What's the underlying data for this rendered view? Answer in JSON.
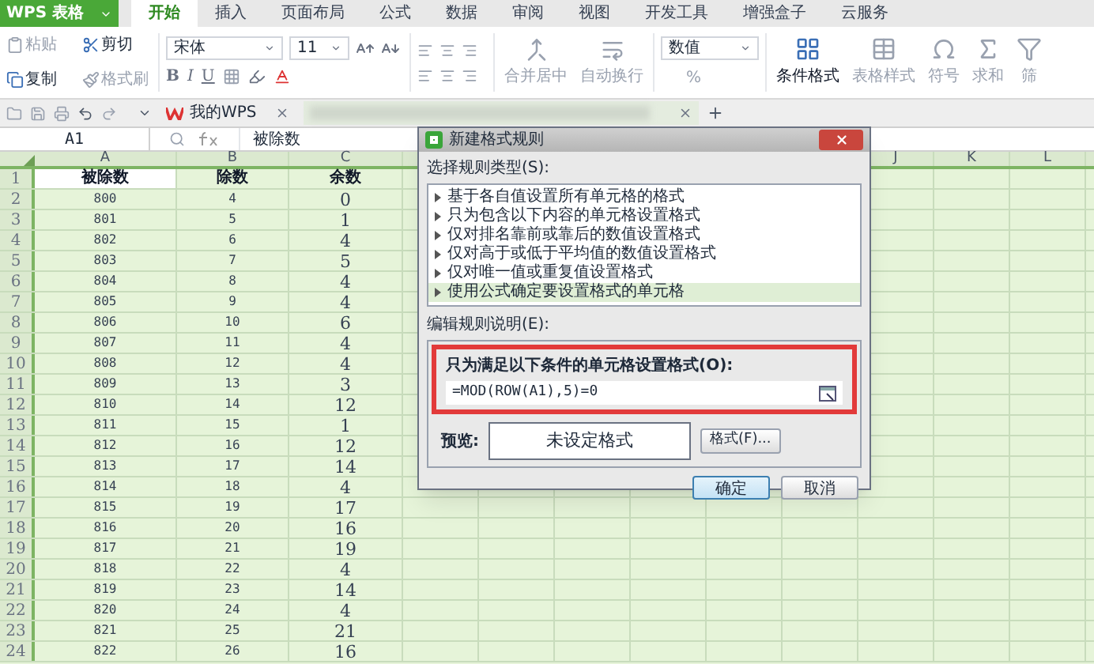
{
  "app": {
    "logo": "WPS 表格"
  },
  "menu_tabs": [
    {
      "label": "开始",
      "selected": true
    },
    {
      "label": "插入",
      "selected": false
    },
    {
      "label": "页面布局",
      "selected": false
    },
    {
      "label": "公式",
      "selected": false
    },
    {
      "label": "数据",
      "selected": false
    },
    {
      "label": "审阅",
      "selected": false
    },
    {
      "label": "视图",
      "selected": false
    },
    {
      "label": "开发工具",
      "selected": false
    },
    {
      "label": "增强盒子",
      "selected": false
    },
    {
      "label": "云服务",
      "selected": false
    }
  ],
  "ribbon": {
    "clipboard": [
      {
        "kind": "paste",
        "label": "粘贴",
        "disabled": true
      },
      {
        "kind": "cut",
        "label": "剪切",
        "disabled": false
      },
      {
        "kind": "copy",
        "label": "复制",
        "disabled": false
      },
      {
        "kind": "painter",
        "label": "格式刷",
        "disabled": true
      }
    ],
    "font": {
      "name": "宋体",
      "size": "11",
      "styles": [
        "B",
        "I",
        "U"
      ]
    },
    "wrap": [
      {
        "kind": "merge",
        "label": "合并居中",
        "disabled": true
      },
      {
        "kind": "wrap",
        "label": "自动换行",
        "disabled": true
      }
    ],
    "number": {
      "format": "数值",
      "percent": "%"
    },
    "big": [
      {
        "kind": "conditional",
        "label": "条件格式",
        "disabled": false
      },
      {
        "kind": "table",
        "label": "表格样式",
        "disabled": true
      },
      {
        "kind": "symbol",
        "label": "符号",
        "disabled": true
      },
      {
        "kind": "sum",
        "label": "求和",
        "disabled": true
      },
      {
        "kind": "filter",
        "label": "筛",
        "disabled": true
      }
    ]
  },
  "doc_tabs": [
    {
      "label": "我的WPS"
    }
  ],
  "formula_bar": {
    "cell": "A1",
    "formula": "被除数"
  },
  "sheet": {
    "columns": [
      "",
      "A",
      "B",
      "C",
      "J",
      "K",
      "L"
    ],
    "header_row": {
      "number": "1",
      "cells": [
        {
          "text": "被除数",
          "selected": true
        },
        {
          "text": "除数",
          "selected": false
        },
        {
          "text": "余数",
          "selected": false
        }
      ]
    },
    "rows": [
      [
        "2",
        "800",
        "4",
        "0"
      ],
      [
        "3",
        "801",
        "5",
        "1"
      ],
      [
        "4",
        "802",
        "6",
        "4"
      ],
      [
        "5",
        "803",
        "7",
        "5"
      ],
      [
        "6",
        "804",
        "8",
        "4"
      ],
      [
        "7",
        "805",
        "9",
        "4"
      ],
      [
        "8",
        "806",
        "10",
        "6"
      ],
      [
        "9",
        "807",
        "11",
        "4"
      ],
      [
        "10",
        "808",
        "12",
        "4"
      ],
      [
        "11",
        "809",
        "13",
        "3"
      ],
      [
        "12",
        "810",
        "14",
        "12"
      ],
      [
        "13",
        "811",
        "15",
        "1"
      ],
      [
        "14",
        "812",
        "16",
        "12"
      ],
      [
        "15",
        "813",
        "17",
        "14"
      ],
      [
        "16",
        "814",
        "18",
        "4"
      ],
      [
        "17",
        "815",
        "19",
        "17"
      ],
      [
        "18",
        "816",
        "20",
        "16"
      ],
      [
        "19",
        "817",
        "21",
        "19"
      ],
      [
        "20",
        "818",
        "22",
        "4"
      ],
      [
        "21",
        "819",
        "23",
        "14"
      ],
      [
        "22",
        "820",
        "24",
        "4"
      ],
      [
        "23",
        "821",
        "25",
        "21"
      ],
      [
        "24",
        "822",
        "26",
        "16"
      ]
    ]
  },
  "dialog": {
    "title": "新建格式规则",
    "rule_type_label": "选择规则类型(S):",
    "rule_types": [
      {
        "label": "基于各自值设置所有单元格的格式",
        "selected": false
      },
      {
        "label": "只为包含以下内容的单元格设置格式",
        "selected": false
      },
      {
        "label": "仅对排名靠前或靠后的数值设置格式",
        "selected": false
      },
      {
        "label": "仅对高于或低于平均值的数值设置格式",
        "selected": false
      },
      {
        "label": "仅对唯一值或重复值设置格式",
        "selected": false
      },
      {
        "label": "使用公式确定要设置格式的单元格",
        "selected": true
      }
    ],
    "edit_label": "编辑规则说明(E):",
    "condition_label": "只为满足以下条件的单元格设置格式(O):",
    "formula": "=MOD(ROW(A1),5)=0",
    "preview_label": "预览:",
    "preview_text": "未设定格式",
    "format_button": "格式(F)...",
    "ok": "确定",
    "cancel": "取消"
  }
}
